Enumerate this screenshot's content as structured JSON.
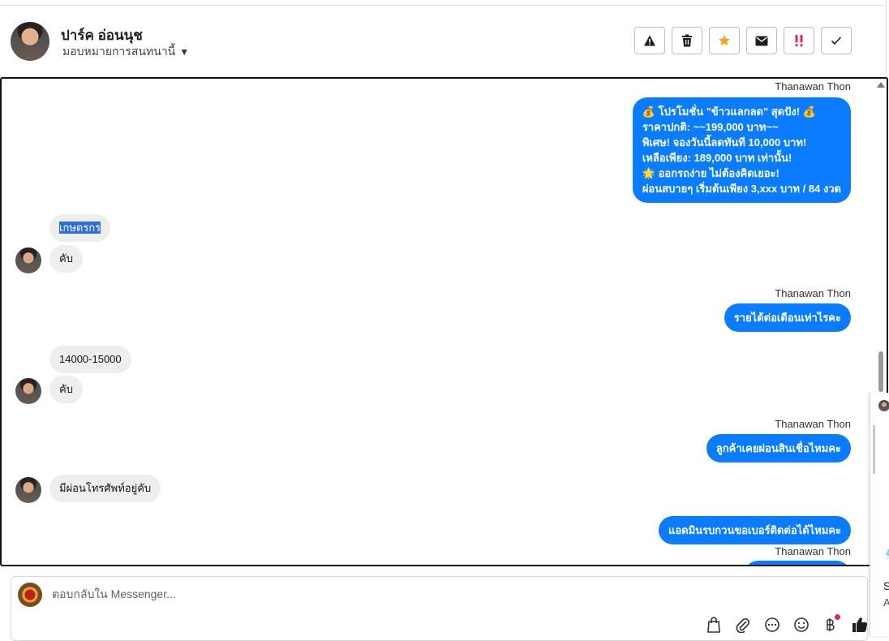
{
  "header": {
    "contact_name": "ปาร์ค อ่อนนุช",
    "assign_label": "มอบหมายการสนทนานี้",
    "actions": [
      {
        "name": "report-button",
        "icon": "warning-icon"
      },
      {
        "name": "delete-button",
        "icon": "trash-icon"
      },
      {
        "name": "star-button",
        "icon": "star-icon",
        "color": "#f5a623"
      },
      {
        "name": "mark-unread-button",
        "icon": "envelope-icon"
      },
      {
        "name": "important-button",
        "icon": "double-exclamation-icon",
        "color": "#e0245e"
      },
      {
        "name": "done-button",
        "icon": "check-icon"
      }
    ]
  },
  "messages": {
    "m1": {
      "sender": "Thanawan Thon",
      "lines": [
        "💰 โปรโมชั่น \"ข้าวแลกลด\" สุดปัง! 💰",
        "ราคาปกติ: ~~199,000 บาท~~",
        "พิเศษ! จองวันนี้ลดทันที 10,000 บาท!",
        "เหลือเพียง: 189,000 บาท เท่านั้น!",
        "🌟 ออกรถง่าย ไม่ต้องคิดเยอะ!",
        "ผ่อนสบายๆ เริ่มต้นเพียง 3,xxx บาท / 84 งวด"
      ]
    },
    "m2": {
      "text": "เกษตรกร"
    },
    "m3": {
      "text": "คับ"
    },
    "m4": {
      "sender": "Thanawan Thon",
      "text": "รายได้ต่อเดือนเท่าไรคะ"
    },
    "m5": {
      "text": "14000-15000"
    },
    "m6": {
      "text": "คับ"
    },
    "m7": {
      "sender": "Thanawan Thon",
      "text": "ลูกค้าเคยผ่อนสินเชื่อไหมคะ"
    },
    "m8": {
      "text": "มีผ่อนโทรศัพท์อยู่คับ"
    },
    "m9": {
      "text": "แอดมินรบกวนขอเบอร์ติดต่อได้ไหมคะ"
    },
    "m10": {
      "sender": "Thanawan Thon"
    }
  },
  "side_panel": {
    "mark": "🎐",
    "line1": "S",
    "line2": "A"
  },
  "composer": {
    "placeholder": "ตอบกลับใน Messenger...",
    "tools": [
      "shopping-bag-icon",
      "paperclip-icon",
      "more-icon",
      "emoji-icon",
      "baht-icon",
      "thumbs-up-icon"
    ]
  },
  "colors": {
    "accent": "#0a7cff",
    "incoming": "#eceeef",
    "highlight": "#2f6ed8"
  }
}
